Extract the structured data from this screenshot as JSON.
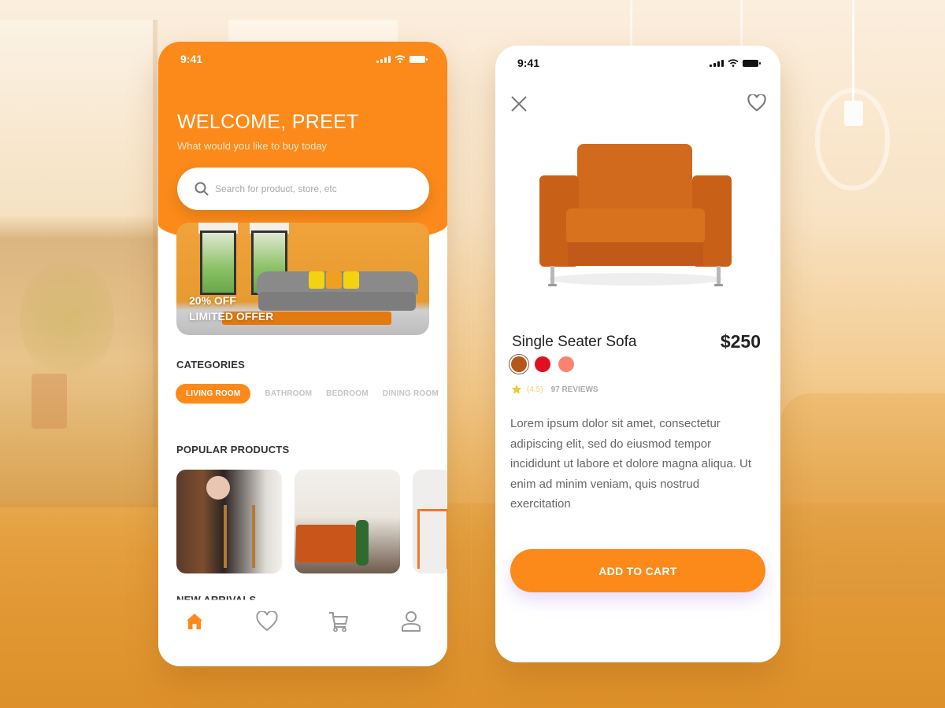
{
  "colors": {
    "accent": "#fb8a1a",
    "text_dark": "#222222",
    "text_muted": "#666666",
    "inactive": "#c4c4c4"
  },
  "home_screen": {
    "status_bar": {
      "time": "9:41"
    },
    "header": {
      "title": "WELCOME, PREET",
      "subtitle": "What would you like to buy today"
    },
    "search": {
      "placeholder": "Search for product, store, etc",
      "icon": "search-icon"
    },
    "banner": {
      "line1": "20% OFF",
      "line2": "LIMITED OFFER"
    },
    "categories": {
      "title": "CATEGORIES",
      "items": [
        {
          "label": "LIVING ROOM",
          "active": true
        },
        {
          "label": "BATHROOM",
          "active": false
        },
        {
          "label": "BEDROOM",
          "active": false
        },
        {
          "label": "DINING ROOM",
          "active": false
        }
      ]
    },
    "popular_products": {
      "title": "POPULAR PRODUCTS",
      "items": [
        {
          "image": "woman-on-wooden-chair"
        },
        {
          "image": "orange-tufted-sofa"
        },
        {
          "image": "orange-metal-stand"
        }
      ]
    },
    "new_arrivals": {
      "title": "NEW ARRIVALS"
    },
    "bottom_nav": [
      {
        "icon": "home-icon",
        "active": true
      },
      {
        "icon": "heart-icon",
        "active": false
      },
      {
        "icon": "cart-icon",
        "active": false
      },
      {
        "icon": "user-icon",
        "active": false
      }
    ]
  },
  "detail_screen": {
    "status_bar": {
      "time": "9:41"
    },
    "close_icon": "close-icon",
    "favorite_icon": "heart-icon",
    "product": {
      "name": "Single Seater Sofa",
      "price": "$250",
      "colors": [
        "#b5561a",
        "#e0101f",
        "#f98472"
      ],
      "selected_color_index": 0,
      "rating": "(4.5)",
      "reviews": "97 REVIEWS",
      "description": "Lorem ipsum dolor sit amet, consectetur adipiscing elit, sed do eiusmod tempor incididunt ut labore et dolore magna aliqua. Ut enim ad minim veniam, quis nostrud exercitation"
    },
    "add_to_cart_label": "ADD TO CART"
  }
}
